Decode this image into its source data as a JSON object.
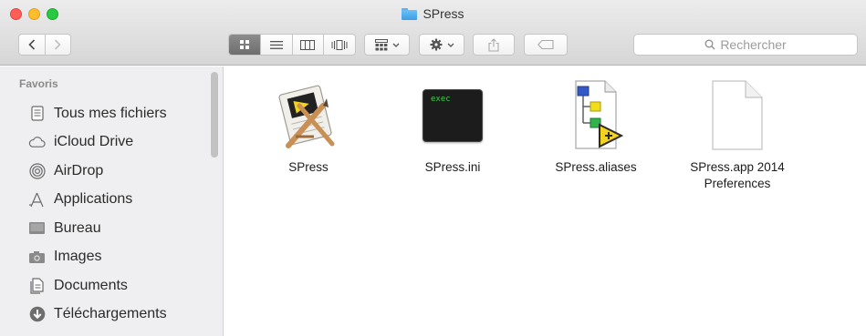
{
  "window": {
    "title": "SPress"
  },
  "toolbar": {
    "back_icon": "chevron-left",
    "forward_icon": "chevron-right",
    "search": {
      "placeholder": "Rechercher"
    }
  },
  "sidebar": {
    "header": "Favoris",
    "items": [
      {
        "label": "Tous mes fichiers",
        "icon": "all-files-icon"
      },
      {
        "label": "iCloud Drive",
        "icon": "cloud-icon"
      },
      {
        "label": "AirDrop",
        "icon": "airdrop-icon"
      },
      {
        "label": "Applications",
        "icon": "applications-icon"
      },
      {
        "label": "Bureau",
        "icon": "desktop-icon"
      },
      {
        "label": "Images",
        "icon": "camera-icon"
      },
      {
        "label": "Documents",
        "icon": "documents-icon"
      },
      {
        "label": "Téléchargements",
        "icon": "download-icon"
      }
    ]
  },
  "files": [
    {
      "name": "SPress",
      "kind": "app-icon"
    },
    {
      "name": "SPress.ini",
      "kind": "terminal-icon",
      "icon_text": "exec"
    },
    {
      "name": "SPress.aliases",
      "kind": "labview-icon"
    },
    {
      "name": "SPress.app 2014 Preferences",
      "kind": "blank-document-icon"
    }
  ],
  "colors": {
    "accent": "#3c9de6",
    "close": "#fd5f57",
    "minimize": "#febc2e",
    "maximize": "#28c840",
    "sidebar_bg": "#efeef0"
  }
}
